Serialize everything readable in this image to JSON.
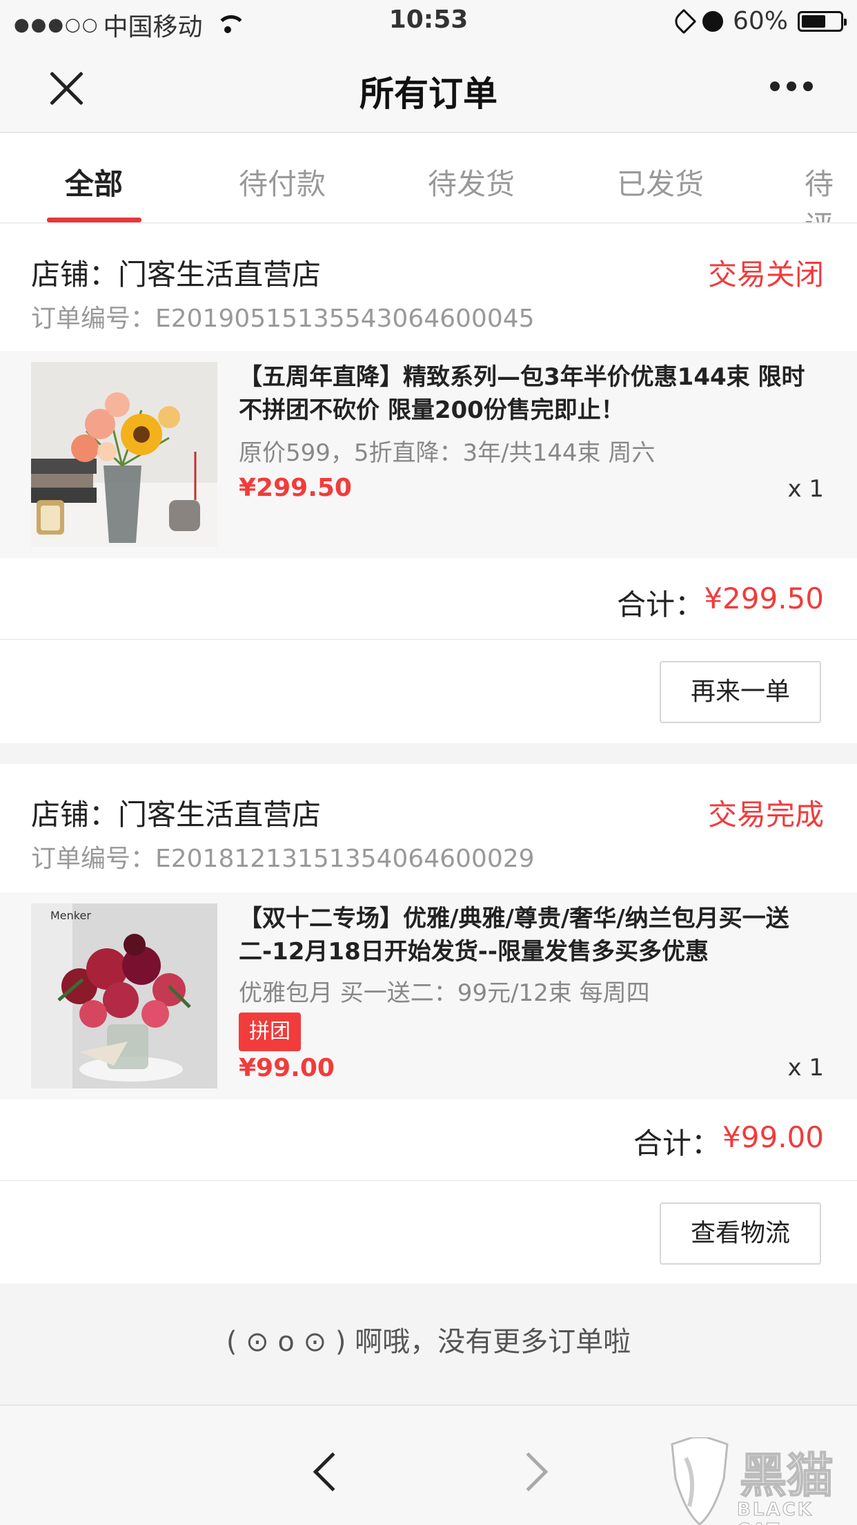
{
  "status_bar": {
    "signal": "●●●○○",
    "carrier": "中国移动",
    "time": "10:53",
    "battery": "60%",
    "battery_level": 0.6
  },
  "nav": {
    "title": "所有订单",
    "close_icon": "close-icon",
    "more_icon": "more-dots-icon"
  },
  "tabs": [
    {
      "label": "全部",
      "active": true
    },
    {
      "label": "待付款"
    },
    {
      "label": "待发货"
    },
    {
      "label": "已发货"
    },
    {
      "label": "待评"
    }
  ],
  "orders": [
    {
      "shop": "店铺：门客生活直营店",
      "status": "交易关闭",
      "order_no": "订单编号：E20190515135543064600045",
      "item_title": "【五周年直降】精致系列—包3年半价优惠144束 限时不拼团不砍价 限量200份售完即止！",
      "item_spec": "原价599，5折直降：3年/共144束 周六",
      "item_price": "¥299.50",
      "item_qty": "x 1",
      "total_label": "合计：",
      "total_value": "¥299.50",
      "action": "再来一单"
    },
    {
      "shop": "店铺：门客生活直营店",
      "status": "交易完成",
      "order_no": "订单编号：E20181213151354064600029",
      "thumb_brand": "Menker",
      "item_title": "【双十二专场】优雅/典雅/尊贵/奢华/纳兰包月买一送二-12月18日开始发货--限量发售多买多优惠",
      "item_spec": "优雅包月 买一送二：99元/12束 每周四",
      "tag": "拼团",
      "item_price": "¥99.00",
      "item_qty": "x 1",
      "total_label": "合计：",
      "total_value": "¥99.00",
      "action": "查看物流"
    }
  ],
  "end_message": "( ⊙ o ⊙ ) 啊哦，没有更多订单啦",
  "toolbar": {
    "back_icon": "back-arrow-icon",
    "forward_icon": "forward-arrow-icon"
  },
  "watermark": {
    "text": "黑猫",
    "sub": "BLACK CAT"
  },
  "colors": {
    "accent": "#f23b3b",
    "tab_underline": "#e5373b"
  }
}
